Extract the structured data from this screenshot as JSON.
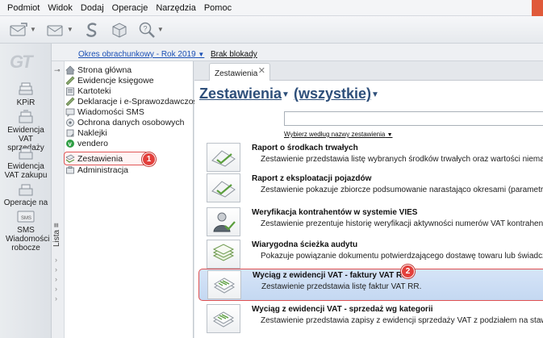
{
  "menu": [
    "Podmiot",
    "Widok",
    "Dodaj",
    "Operacje",
    "Narzędzia",
    "Pomoc"
  ],
  "toolbar": {
    "buttons": [
      {
        "icon": "envelope-send-icon",
        "has_dropdown": true
      },
      {
        "icon": "envelope-receive-icon",
        "has_dropdown": true
      },
      {
        "icon": "symbol-s-icon",
        "has_dropdown": false
      },
      {
        "icon": "package-icon",
        "has_dropdown": false
      },
      {
        "icon": "help-search-icon",
        "has_dropdown": true
      }
    ]
  },
  "iconbar": {
    "logo": "GT",
    "items": [
      {
        "label": "KPiR",
        "icon": "book-stack-icon"
      },
      {
        "label": "Ewidencja VAT sprzedaży",
        "icon": "vat-sales-icon"
      },
      {
        "label": "Ewidencja VAT zakupu",
        "icon": "vat-purchase-icon"
      },
      {
        "label": "Operacje na środkach trw.",
        "icon": "fixed-assets-icon"
      },
      {
        "label": "SMS Wiadomości robocze",
        "icon": "sms-icon"
      }
    ]
  },
  "topstrip": {
    "period_label": "Okres obrachunkowy - Rok 2019",
    "block_label": "Brak blokady"
  },
  "tree": {
    "side_label": "Lista",
    "items": [
      {
        "label": "Strona główna",
        "icon": "home-icon"
      },
      {
        "label": "Ewidencje księgowe",
        "icon": "ledger-icon"
      },
      {
        "label": "Kartoteki",
        "icon": "card-file-icon"
      },
      {
        "label": "Deklaracje i e-Sprawozdawczość",
        "icon": "declaration-icon"
      },
      {
        "label": "Wiadomości SMS",
        "icon": "sms-message-icon"
      },
      {
        "label": "Ochrona danych osobowych",
        "icon": "data-protection-icon"
      },
      {
        "label": "Naklejki",
        "icon": "sticker-icon"
      },
      {
        "label": "vendero",
        "icon": "vendero-icon"
      },
      {
        "label": "Zestawienia",
        "icon": "reports-icon"
      },
      {
        "label": "Administracja",
        "icon": "admin-icon"
      }
    ],
    "selected_index": 8,
    "badge": "1"
  },
  "main": {
    "tab_label": "Zestawienia",
    "heading_main": "Zestawienia",
    "heading_filter": "(wszystkie)",
    "search_value": "",
    "sort_label": "Wybierz według nazwy zestawienia",
    "badge": "2",
    "highlight_index": 4,
    "reports": [
      {
        "title": "Raport o środkach trwałych",
        "desc": "Zestawienie przedstawia listę wybranych środków trwałych oraz wartości niematerialnych",
        "icon": "chart-check-icon"
      },
      {
        "title": "Raport z eksploatacji pojazdów",
        "desc": "Zestawienie pokazuje zbiorcze podsumowanie narastająco okresami (parametr) z ewidencji",
        "icon": "chart-check-icon"
      },
      {
        "title": "Weryfikacja kontrahentów w systemie VIES",
        "desc": "Zestawienie prezentuje historię weryfikacji aktywności numerów VAT kontrahentów w systemie",
        "icon": "person-check-icon"
      },
      {
        "title": "Wiarygodna ścieżka audytu",
        "desc": "Pokazuje powiązanie dokumentu potwierdzającego dostawę towaru lub świadczenie usługi",
        "icon": "stacked-sheets-icon"
      },
      {
        "title": "Wyciąg z ewidencji VAT - faktury VAT RR",
        "desc": "Zestawienie przedstawia listę faktur VAT RR.",
        "icon": "document-list-icon"
      },
      {
        "title": "Wyciąg z ewidencji VAT - sprzedaż wg kategorii",
        "desc": "Zestawienie przedstawia zapisy z ewidencji sprzedaży VAT z podziałem na stawki VAT i",
        "icon": "document-list-icon"
      }
    ]
  },
  "colors": {
    "accent_red": "#e3403c",
    "heading_blue": "#2e4f7a",
    "link_blue": "#1a4fb5",
    "highlight_bg": "#c4d8f2"
  }
}
